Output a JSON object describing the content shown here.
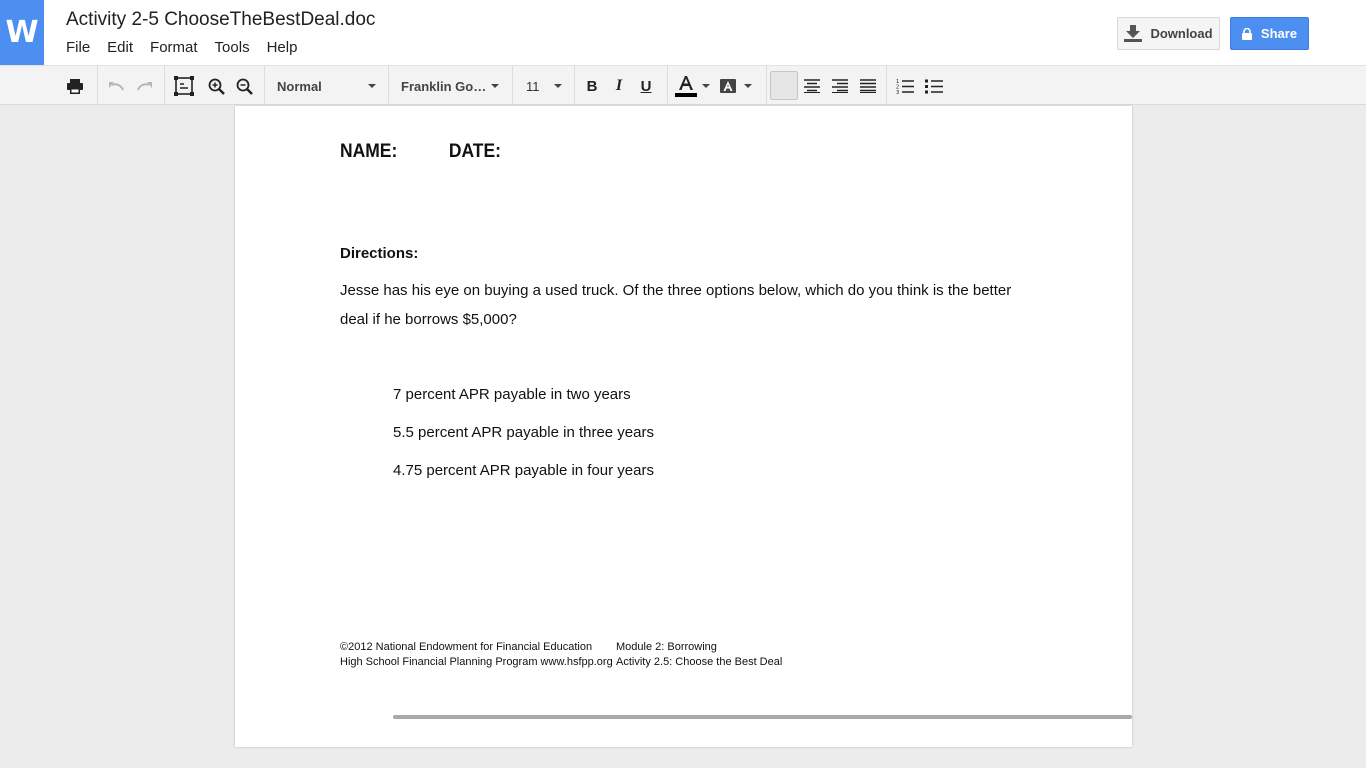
{
  "app": {
    "logo_letter": "W"
  },
  "document": {
    "title": "Activity 2-5 ChooseTheBestDeal.doc"
  },
  "menu": [
    "File",
    "Edit",
    "Format",
    "Tools",
    "Help"
  ],
  "actions": {
    "download_label": "Download",
    "share_label": "Share"
  },
  "toolbar": {
    "style_value": "Normal",
    "font_value": "Franklin Go…",
    "size_value": "11",
    "text_color": "#000000"
  },
  "colors": {
    "accent": "#4d8ff0"
  },
  "content": {
    "name_label": "NAME:",
    "date_label": "DATE:",
    "directions_heading": "Directions:",
    "directions_text": "Jesse has his eye on buying a used truck. Of the three options below, which do you think is the better deal if he borrows $5,000?",
    "options": [
      "7 percent APR payable in two years",
      "5.5 percent APR payable in three years",
      "4.75 percent APR payable in four years"
    ],
    "footer": {
      "left_1": "©2012 National Endowment for Financial Education",
      "right_1": "Module 2: Borrowing",
      "left_2": "High School Financial Planning Program www.hsfpp.org",
      "right_2": "Activity 2.5: Choose the Best Deal"
    }
  }
}
